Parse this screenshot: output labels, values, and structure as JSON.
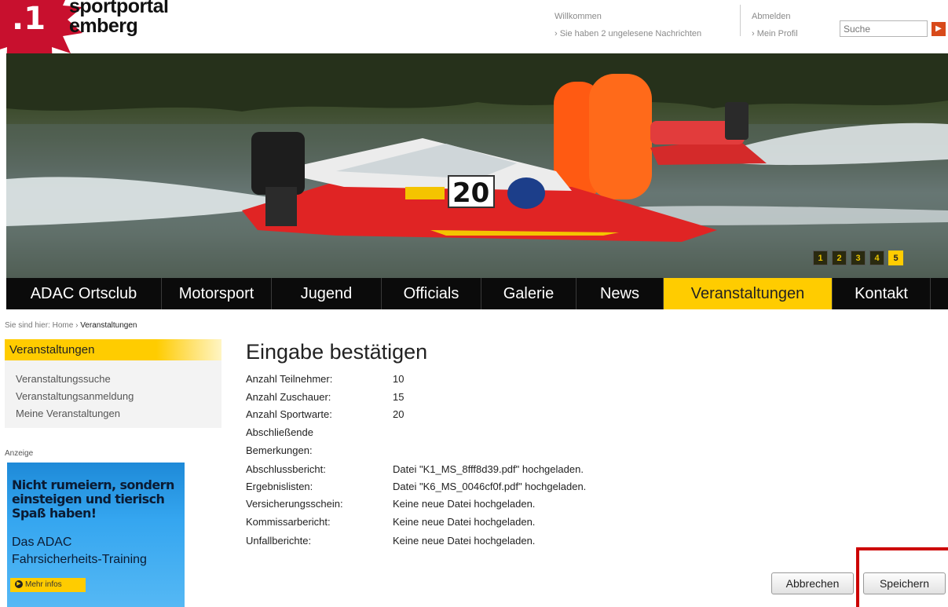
{
  "header": {
    "badge_text": ".1",
    "logo_line1": "sportportal",
    "logo_line2": "emberg",
    "welcome": "Willkommen",
    "messages": "› Sie haben 2 ungelesene Nachrichten",
    "logout": "Abmelden",
    "profile": "› Mein Profil",
    "search_placeholder": "Suche",
    "search_button_icon": "arrow-right-icon"
  },
  "hero": {
    "slides": [
      "1",
      "2",
      "3",
      "4",
      "5"
    ],
    "active_slide": "5",
    "boat_number": "20"
  },
  "nav": {
    "items": [
      "ADAC Ortsclub",
      "Motorsport",
      "Jugend",
      "Officials",
      "Galerie",
      "News",
      "Veranstaltungen",
      "Kontakt"
    ],
    "active": "Veranstaltungen"
  },
  "breadcrumb": {
    "prefix": "Sie sind hier:",
    "home": "Home",
    "separator": "›",
    "current": "Veranstaltungen"
  },
  "sidebar": {
    "heading": "Veranstaltungen",
    "items": [
      "Veranstaltungssuche",
      "Veranstaltungsanmeldung",
      "Meine Veranstaltungen"
    ],
    "ad_label": "Anzeige",
    "ad_headline_1": "Nicht rumeiern, sondern",
    "ad_headline_2": "einsteigen und tierisch",
    "ad_headline_3": "Spaß haben!",
    "ad_sub_1": "Das ADAC",
    "ad_sub_2": "Fahrsicherheits-Training",
    "ad_button": "Mehr infos"
  },
  "main": {
    "title": "Eingabe bestätigen",
    "rows": [
      {
        "label": "Anzahl Teilnehmer:",
        "value": "10"
      },
      {
        "label": "Anzahl Zuschauer:",
        "value": "15"
      },
      {
        "label": "Anzahl Sportwarte:",
        "value": "20"
      },
      {
        "label": "Abschließende",
        "value": ""
      },
      {
        "label": "Bemerkungen:",
        "value": ""
      },
      {
        "label": "Abschlussbericht:",
        "value": "Datei \"K1_MS_8fff8d39.pdf\" hochgeladen."
      },
      {
        "label": "Ergebnislisten:",
        "value": "Datei \"K6_MS_0046cf0f.pdf\" hochgeladen."
      },
      {
        "label": "Versicherungsschein:",
        "value": "Keine neue Datei hochgeladen."
      },
      {
        "label": "Kommissarbericht:",
        "value": "Keine neue Datei hochgeladen."
      },
      {
        "label": "Unfallberichte:",
        "value": "Keine neue Datei hochgeladen."
      }
    ],
    "cancel_label": "Abbrechen",
    "save_label": "Speichern"
  },
  "colors": {
    "accent": "#ffcc00",
    "nav_bg": "#0b0b0b",
    "highlight": "#cc0000"
  }
}
